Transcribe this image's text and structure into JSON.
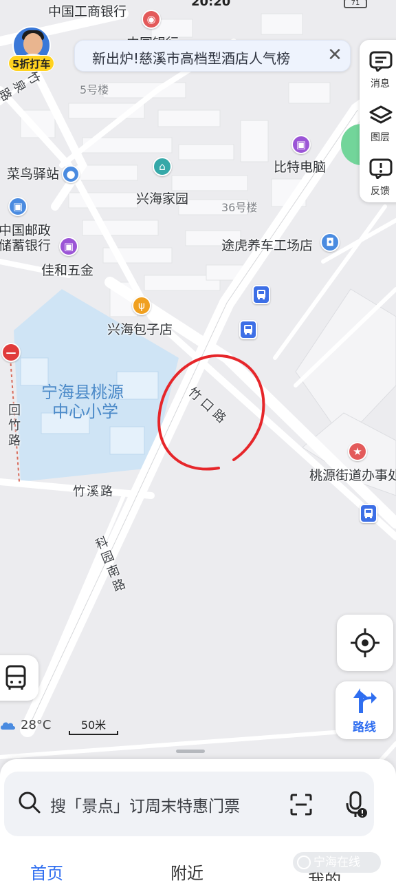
{
  "status_bar": {
    "time": "20:20",
    "battery": "71"
  },
  "promo": {
    "badge": "5折打车"
  },
  "banner": {
    "text": "新出炉!慈溪市高档型酒店人气榜",
    "close": "✕"
  },
  "side_panel": {
    "items": [
      {
        "label": "消息",
        "icon": "message-icon"
      },
      {
        "label": "图层",
        "icon": "layers-icon"
      },
      {
        "label": "反馈",
        "icon": "feedback-icon"
      }
    ]
  },
  "map": {
    "labels": {
      "icbc": "中国工商银行",
      "boc": "中国银行",
      "zhuquan_road": "竹泉路",
      "bldg5": "5号楼",
      "cainiao": "菜鸟驿站",
      "xinghai_home": "兴海家园",
      "bite": "比特电脑",
      "bldg36": "36号楼",
      "postal_line1": "中国邮政",
      "postal_line2": "储蓄银行",
      "tuhu": "途虎养车工场店",
      "jiahe": "佳和五金",
      "baozi": "兴海包子店",
      "school_line1": "宁海县桃源",
      "school_line2": "中心小学",
      "zhukou_road": "竹口路",
      "huizhu_road": "回竹路",
      "zhuxi_road": "竹溪路",
      "taoyuan_office": "桃源街道办事处",
      "keyuan_road": "科园南路"
    },
    "colors": {
      "road": "#ffffff",
      "block": "#f7f7f9",
      "school": "#cfe4f5",
      "annotation": "#e6262a",
      "primary": "#2f6ef0"
    }
  },
  "controls": {
    "weather": "28°C",
    "scale": "50米",
    "route": "路线"
  },
  "bottom_sheet": {
    "search_placeholder": "搜「景点」订周末特惠门票",
    "tabs": [
      "首页",
      "附近",
      "我的"
    ]
  },
  "watermark": "宁海在线"
}
